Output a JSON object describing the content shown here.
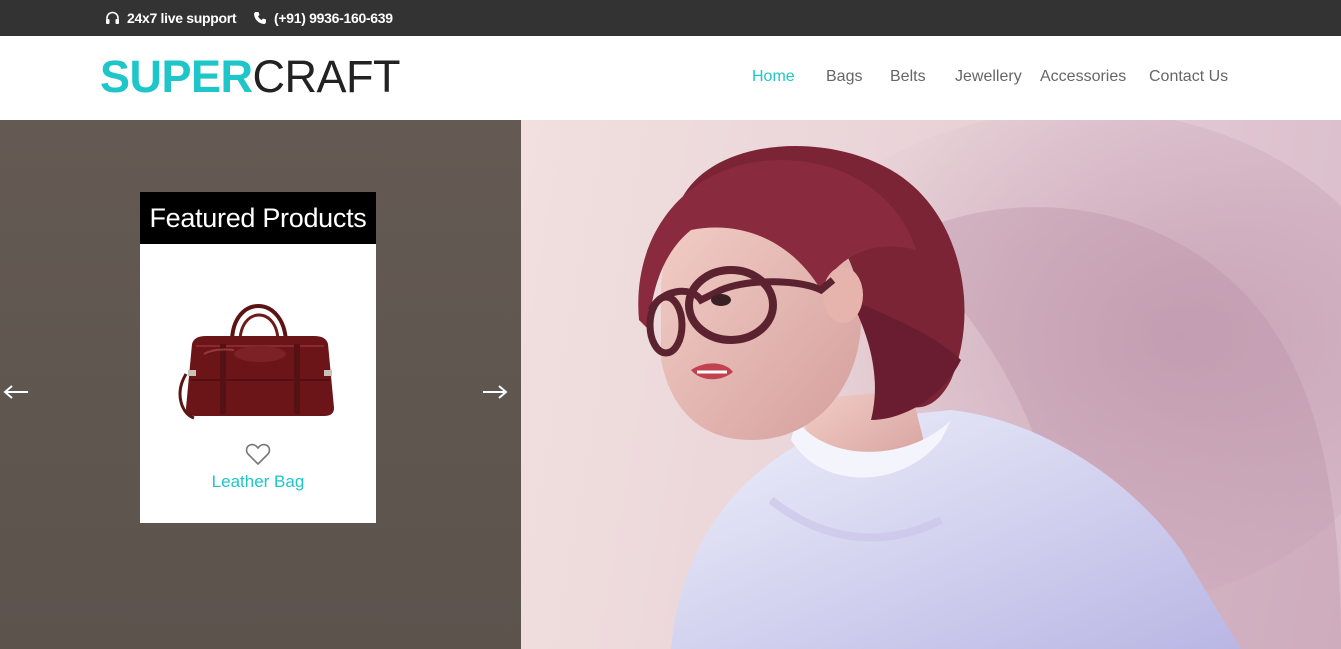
{
  "topbar": {
    "support_text": "24x7 live support",
    "phone_text": "(+91) 9936-160-639",
    "support_icon": "headphones-icon",
    "phone_icon": "phone-icon"
  },
  "header": {
    "logo_part1": "SUPER",
    "logo_part2": "CRAFT",
    "nav": [
      {
        "label": "Home",
        "active": true
      },
      {
        "label": "Bags"
      },
      {
        "label": "Belts"
      },
      {
        "label": "Jewellery"
      },
      {
        "label": "Accessories"
      },
      {
        "label": "Contact Us"
      }
    ]
  },
  "hero": {
    "featured_title": "Featured Products",
    "product_name": "Leather Bag",
    "prev_icon": "arrow-left-icon",
    "next_icon": "arrow-right-icon",
    "wishlist_icon": "heart-icon"
  },
  "colors": {
    "accent": "#1ec6c9",
    "topbar_bg": "#333333",
    "hero_left_bg": "#5f5650",
    "nav_text": "#666666"
  }
}
